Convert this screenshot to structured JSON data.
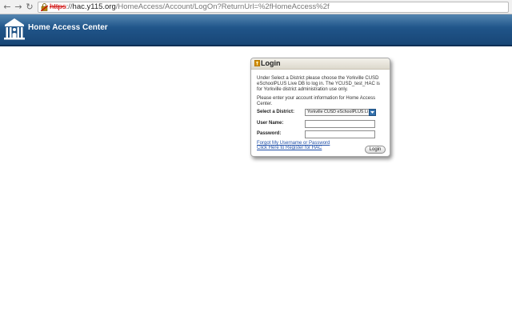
{
  "browser": {
    "url_scheme": "https",
    "url_sep": "://",
    "url_host": "hac.y115.org",
    "url_path": "/HomeAccess/Account/LogOn?ReturnUrl=%2fHomeAccess%2f",
    "back": "←",
    "forward": "→",
    "reload": "↻"
  },
  "header": {
    "title": "Home Access Center"
  },
  "login": {
    "title": "Login",
    "instructions": "Under Select a District please choose the Yorkville CUSD eSchoolPLUS Live DB to log in. The YCUSD_test_HAC is for Yorkville district administration use only.",
    "prompt": "Please enter your account information for Home Access Center.",
    "district_label": "Select a District:",
    "district_value": "Yorkville CUSD eSchoolPLUS Live DB",
    "username_label": "User Name:",
    "password_label": "Password:",
    "forgot_link": "Forgot My Username or Password",
    "register_link": "Click Here to Register for HAC",
    "login_button": "Login"
  },
  "colors": {
    "banner": "#1f5387",
    "link": "#1f4fa8",
    "url_scheme_error": "#cc0000"
  }
}
